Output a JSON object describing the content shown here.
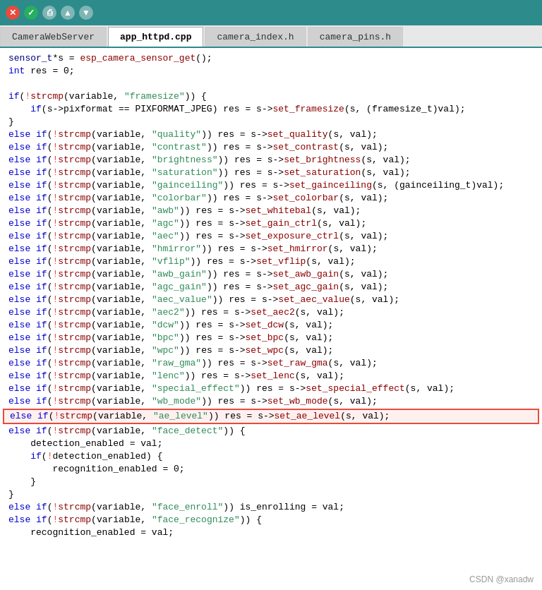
{
  "titlebar": {
    "buttons": [
      "close",
      "minimize",
      "document",
      "up",
      "down"
    ]
  },
  "tabs": [
    {
      "label": "CameraWebServer",
      "active": false
    },
    {
      "label": "app_httpd.cpp",
      "active": true
    },
    {
      "label": "camera_index.h",
      "active": false
    },
    {
      "label": "camera_pins.h",
      "active": false
    }
  ],
  "watermark": "CSDN @xanadw",
  "code_lines": [
    "sensor_t *s = esp_camera_sensor_get();",
    "int res = 0;",
    "",
    "if(!strcmp(variable, \"framesize\")) {",
    "    if(s->pixformat == PIXFORMAT_JPEG) res = s->set_framesize(s, (framesize_t)val);",
    "}",
    "else if(!strcmp(variable, \"quality\")) res = s->set_quality(s, val);",
    "else if(!strcmp(variable, \"contrast\")) res = s->set_contrast(s, val);",
    "else if(!strcmp(variable, \"brightness\")) res = s->set_brightness(s, val);",
    "else if(!strcmp(variable, \"saturation\")) res = s->set_saturation(s, val);",
    "else if(!strcmp(variable, \"gainceiling\")) res = s->set_gainceiling(s, (gainceiling_t)val);",
    "else if(!strcmp(variable, \"colorbar\")) res = s->set_colorbar(s, val);",
    "else if(!strcmp(variable, \"awb\")) res = s->set_whitebal(s, val);",
    "else if(!strcmp(variable, \"agc\")) res = s->set_gain_ctrl(s, val);",
    "else if(!strcmp(variable, \"aec\")) res = s->set_exposure_ctrl(s, val);",
    "else if(!strcmp(variable, \"hmirror\")) res = s->set_hmirror(s, val);",
    "else if(!strcmp(variable, \"vflip\")) res = s->set_vflip(s, val);",
    "else if(!strcmp(variable, \"awb_gain\")) res = s->set_awb_gain(s, val);",
    "else if(!strcmp(variable, \"agc_gain\")) res = s->set_agc_gain(s, val);",
    "else if(!strcmp(variable, \"aec_value\")) res = s->set_aec_value(s, val);",
    "else if(!strcmp(variable, \"aec2\")) res = s->set_aec2(s, val);",
    "else if(!strcmp(variable, \"dcw\")) res = s->set_dcw(s, val);",
    "else if(!strcmp(variable, \"bpc\")) res = s->set_bpc(s, val);",
    "else if(!strcmp(variable, \"wpc\")) res = s->set_wpc(s, val);",
    "else if(!strcmp(variable, \"raw_gma\")) res = s->set_raw_gma(s, val);",
    "else if(!strcmp(variable, \"lenc\")) res = s->set_lenc(s, val);",
    "else if(!strcmp(variable, \"special_effect\")) res = s->set_special_effect(s, val);",
    "else if(!strcmp(variable, \"wb_mode\")) res = s->set_wb_mode(s, val);",
    "HIGHLIGHTED:else if(!strcmp(variable, \"ae_level\")) res = s->set_ae_level(s, val);",
    "else if(!strcmp(variable, \"face_detect\")) {",
    "    detection_enabled = val;",
    "    if(!detection_enabled) {",
    "        recognition_enabled = 0;",
    "    }",
    "}",
    "else if(!strcmp(variable, \"face_enroll\")) is_enrolling = val;",
    "else if(!strcmp(variable, \"face_recognize\")) {",
    "    recognition_enabled = val;"
  ]
}
